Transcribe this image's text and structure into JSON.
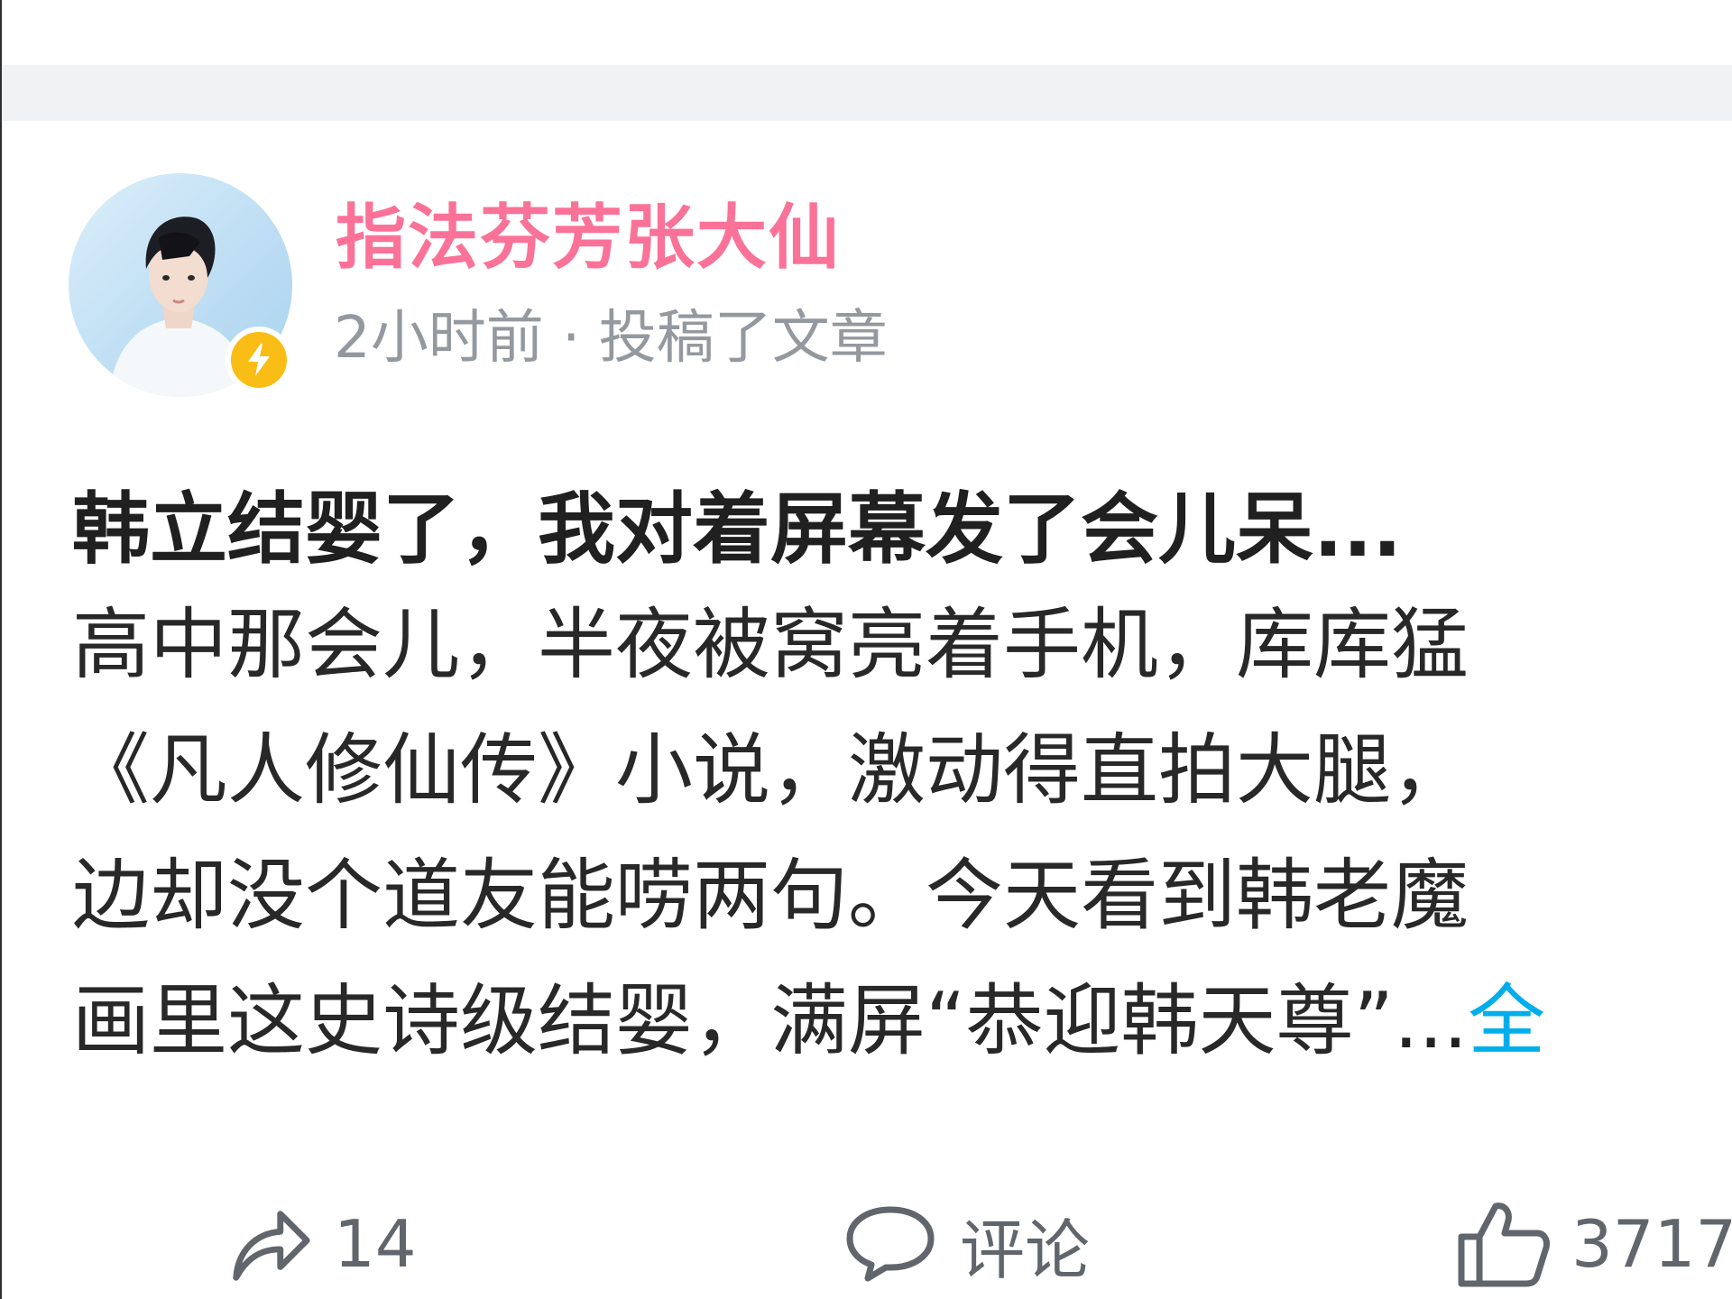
{
  "post": {
    "author_name": "指法芬芳张大仙",
    "meta": "2小时前 · 投稿了文章",
    "title": "韩立结婴了，我对着屏幕发了会儿呆...",
    "body_lines": [
      "高中那会儿，半夜被窝亮着手机，库库猛",
      "《凡人修仙传》小说，激动得直拍大腿，",
      "边却没个道友能唠两句。今天看到韩老魔",
      "画里这史诗级结婴，满屏“恭迎韩天尊”"
    ],
    "truncation": "...",
    "more_link": "全"
  },
  "actions": {
    "share_count": "14",
    "comment_label": "评论",
    "like_count": "3717"
  },
  "icons": {
    "share": "share-icon",
    "comment": "comment-icon",
    "like": "thumbs-up-icon",
    "badge": "lightning-icon"
  },
  "colors": {
    "author_name": "#fb7299",
    "meta_gray": "#9499a0",
    "badge_yellow": "#f9bd16",
    "link_blue": "#00aeec",
    "action_gray": "#61666d",
    "separator_gray": "#f1f2f3"
  }
}
